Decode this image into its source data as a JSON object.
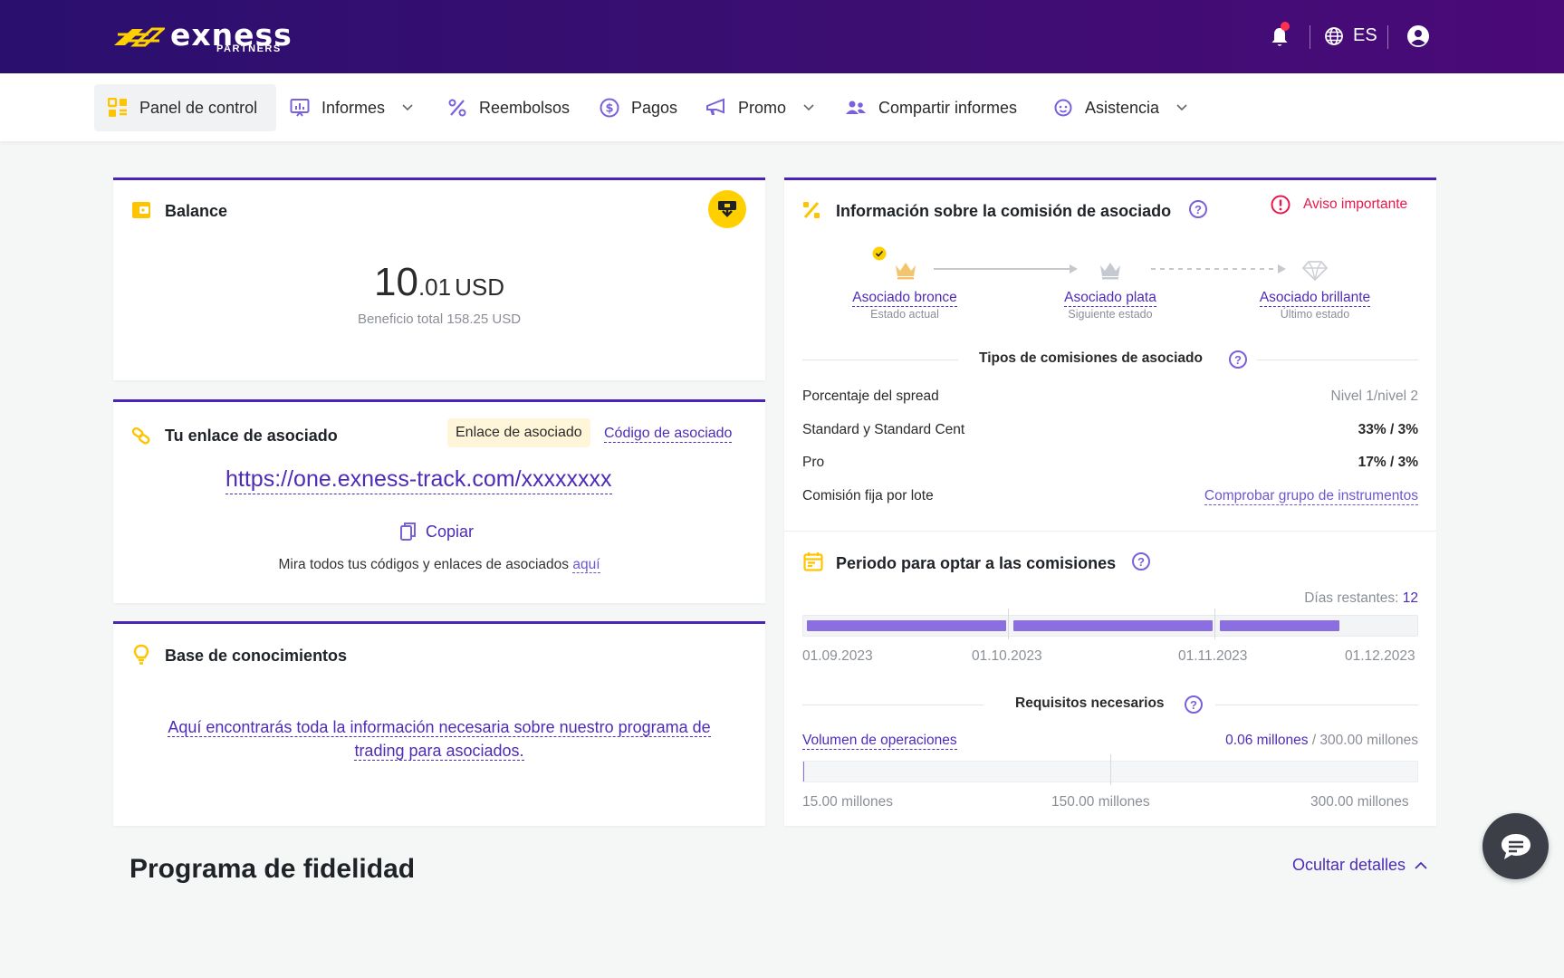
{
  "header": {
    "logo_word": "exness",
    "logo_sub": "PARTNERS",
    "language": "ES"
  },
  "nav": [
    {
      "label": "Panel de control",
      "icon": "dashboard-icon"
    },
    {
      "label": "Informes",
      "icon": "reports-icon"
    },
    {
      "label": "Reembolsos",
      "icon": "percent-icon"
    },
    {
      "label": "Pagos",
      "icon": "dollar-circle-icon"
    },
    {
      "label": "Promo",
      "icon": "megaphone-icon"
    },
    {
      "label": "Compartir informes",
      "icon": "users-icon"
    },
    {
      "label": "Asistencia",
      "icon": "support-icon"
    }
  ],
  "balance": {
    "title": "Balance",
    "amount_int": "10",
    "amount_dec": ".01",
    "currency": "USD",
    "total_profit": "Beneficio total 158.25 USD"
  },
  "affiliate": {
    "title": "Tu enlace de asociado",
    "tab_active": "Enlace de asociado",
    "tab_other": "Código de asociado",
    "url": "https://one.exness-track.com/xxxxxxxx",
    "copy_label": "Copiar",
    "note": "Mira todos tus códigos y enlaces de asociados",
    "note_link": "aquí"
  },
  "knowledge": {
    "title": "Base de conocimientos",
    "link_line1": "Aquí encontrarás toda la información necesaria sobre nuestro programa de",
    "link_line2": "trading para asociados."
  },
  "commission": {
    "title": "Información sobre la comisión de asociado",
    "warning": "Aviso importante",
    "tiers": [
      {
        "name": "Asociado bronce",
        "status": "Estado actual"
      },
      {
        "name": "Asociado plata",
        "status": "Siguiente estado"
      },
      {
        "name": "Asociado brillante",
        "status": "Último estado"
      }
    ],
    "types_title": "Tipos de comisiones de asociado",
    "rows": [
      {
        "label": "Porcentaje del spread",
        "value": "Nivel 1/nivel 2"
      },
      {
        "label": "Standard y Standard Cent",
        "value": "33% / 3%"
      },
      {
        "label": "Pro",
        "value": "17% / 3%"
      },
      {
        "label": "Comisión fija por lote",
        "value": "Comprobar grupo de instrumentos"
      }
    ]
  },
  "period": {
    "title": "Periodo para optar a las comisiones",
    "days_label": "Días restantes:",
    "days_value": "12",
    "dates": [
      "01.09.2023",
      "01.10.2023",
      "01.11.2023",
      "01.12.2023"
    ],
    "segment_fill": [
      1,
      1,
      0.6
    ],
    "requirements_title": "Requisitos necesarios",
    "volume_label": "Volumen de operaciones",
    "volume_current": "0.06 millones",
    "volume_total": "/ 300.00 millones",
    "volume_fraction": 0.0002,
    "volume_marks": [
      "15.00 millones",
      "150.00 millones",
      "300.00 millones"
    ]
  },
  "loyalty": {
    "title": "Programa de fidelidad",
    "toggle": "Ocultar detalles"
  },
  "colors": {
    "accent": "#4e2bb8",
    "brand_yellow": "#ffd000",
    "warning": "#e5194b",
    "progress": "#8b6ee0"
  }
}
